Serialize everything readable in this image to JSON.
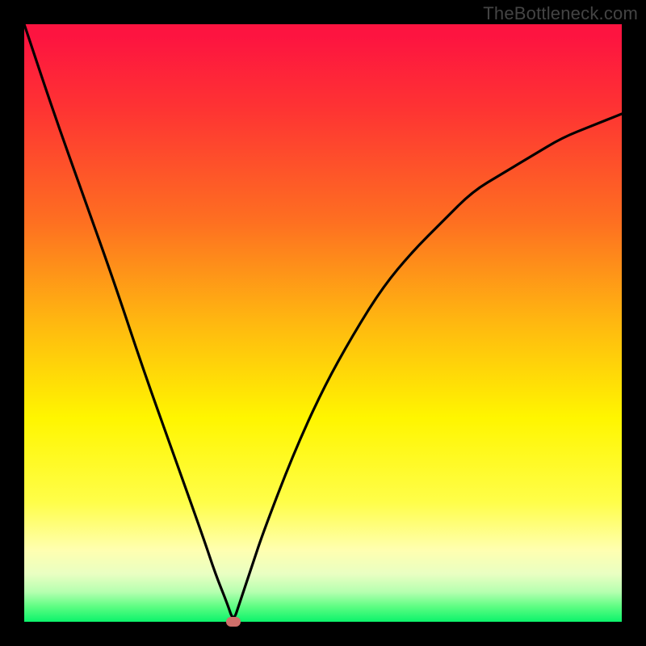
{
  "watermark": "TheBottleneck.com",
  "colors": {
    "frame": "#000000",
    "curve": "#000000",
    "marker": "#cf6f6a",
    "gradient_top": "#fd1440",
    "gradient_bottom": "#0cf36b"
  },
  "chart_data": {
    "type": "line",
    "title": "",
    "xlabel": "",
    "ylabel": "",
    "xlim": [
      0,
      100
    ],
    "ylim": [
      0,
      100
    ],
    "x": [
      0,
      5,
      10,
      15,
      20,
      25,
      30,
      32,
      34,
      35,
      36,
      38,
      40,
      45,
      50,
      55,
      60,
      65,
      70,
      75,
      80,
      85,
      90,
      95,
      100
    ],
    "values": [
      100,
      85,
      71,
      57,
      42,
      28,
      14,
      8,
      3,
      0,
      3,
      9,
      15,
      28,
      39,
      48,
      56,
      62,
      67,
      72,
      75,
      78,
      81,
      83,
      85
    ],
    "marker": {
      "x": 35,
      "y": 0
    },
    "annotations": []
  }
}
